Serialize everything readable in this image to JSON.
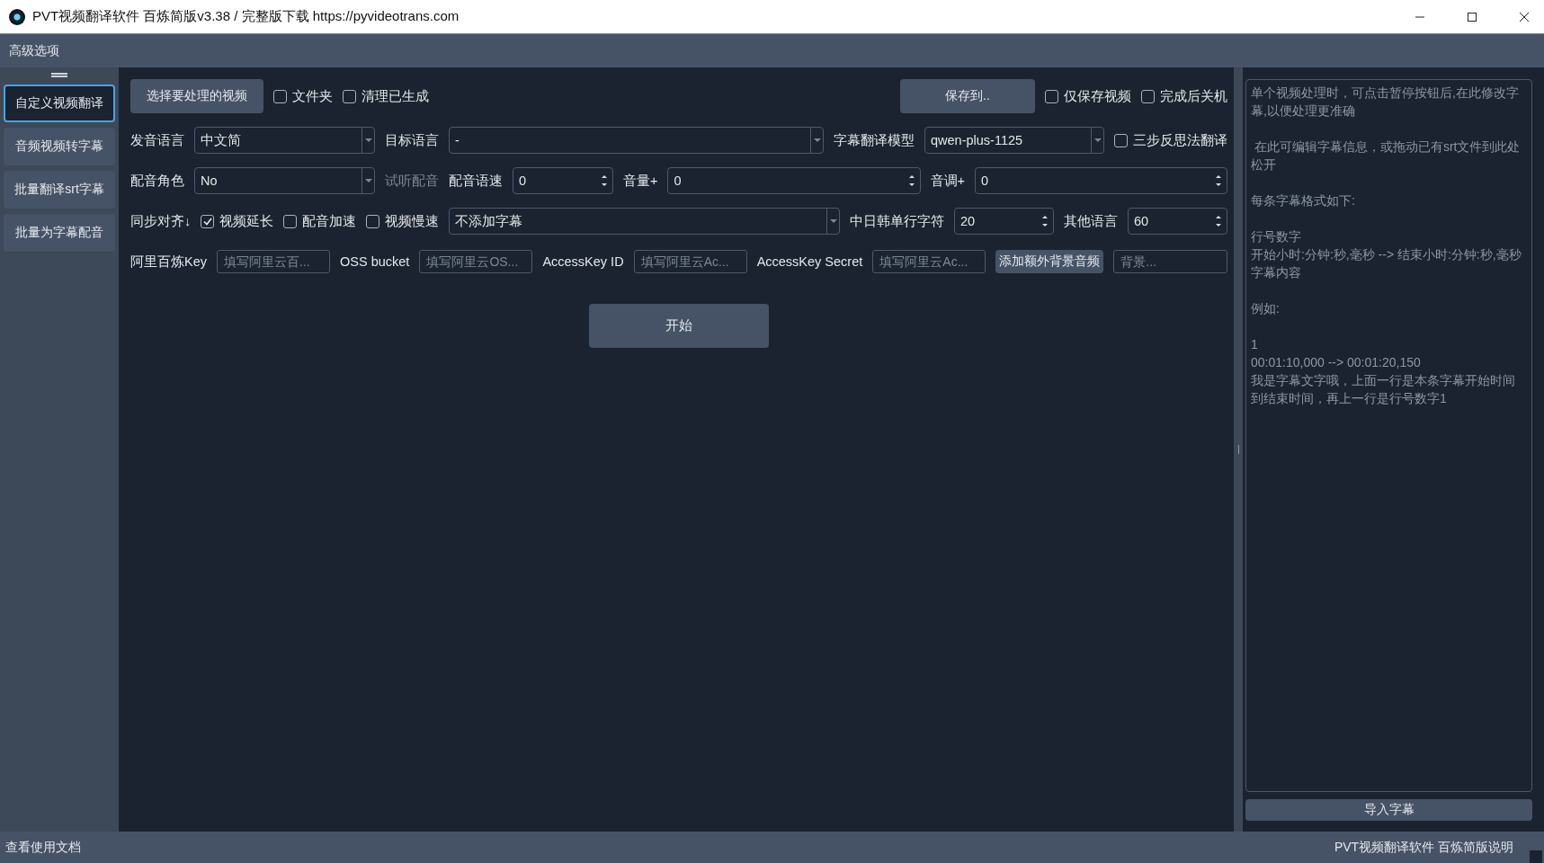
{
  "window": {
    "title": "PVT视频翻译软件 百炼简版v3.38 / 完整版下载 https://pyvideotrans.com"
  },
  "menu": [
    "高级选项"
  ],
  "sidebar": {
    "items": [
      {
        "label": "自定义视频翻译",
        "selected": true
      },
      {
        "label": "音频视频转字幕",
        "selected": false
      },
      {
        "label": "批量翻译srt字幕",
        "selected": false
      },
      {
        "label": "批量为字幕配音",
        "selected": false
      }
    ]
  },
  "form_rows": [
    [
      {
        "kind": "button",
        "label": "选择要处理的视频"
      },
      {
        "kind": "check",
        "label": "文件夹",
        "checked": false
      },
      {
        "kind": "check",
        "label": "清理已生成",
        "checked": false
      },
      {
        "kind": "button",
        "label": "保存到.."
      },
      {
        "kind": "check",
        "label": "仅保存视频",
        "checked": false
      },
      {
        "kind": "check",
        "label": "完成后关机",
        "checked": false
      }
    ],
    [
      {
        "kind": "label",
        "label": "发音语言"
      },
      {
        "kind": "combo",
        "value": "中文简"
      },
      {
        "kind": "label",
        "label": "目标语言"
      },
      {
        "kind": "combo",
        "value": "-"
      },
      {
        "kind": "label",
        "label": "字幕翻译模型"
      },
      {
        "kind": "combo",
        "value": "qwen-plus-1125"
      },
      {
        "kind": "check",
        "label": "三步反思法翻译",
        "checked": false
      }
    ],
    [
      {
        "kind": "label",
        "label": "配音角色"
      },
      {
        "kind": "combo",
        "value": "No"
      },
      {
        "kind": "label",
        "label": "试听配音",
        "disabled": true
      },
      {
        "kind": "label",
        "label": "配音语速"
      },
      {
        "kind": "spin",
        "value": "0"
      },
      {
        "kind": "label",
        "label": "音量+"
      },
      {
        "kind": "spin",
        "value": "0"
      },
      {
        "kind": "label",
        "label": "音调+"
      },
      {
        "kind": "spin",
        "value": "0"
      }
    ],
    [
      {
        "kind": "label",
        "label": "同步对齐↓"
      },
      {
        "kind": "check",
        "label": "视频延长",
        "checked": true
      },
      {
        "kind": "check",
        "label": "配音加速",
        "checked": false
      },
      {
        "kind": "check",
        "label": "视频慢速",
        "checked": false
      },
      {
        "kind": "combo",
        "value": "不添加字幕"
      },
      {
        "kind": "label",
        "label": "中日韩单行字符"
      },
      {
        "kind": "spin",
        "value": "20"
      },
      {
        "kind": "label",
        "label": "其他语言"
      },
      {
        "kind": "spin",
        "value": "60"
      }
    ],
    [
      {
        "kind": "label",
        "label": "阿里百炼Key"
      },
      {
        "kind": "input",
        "placeholder": "填写阿里云百..."
      },
      {
        "kind": "label",
        "label": "OSS bucket"
      },
      {
        "kind": "input",
        "placeholder": "填写阿里云OS..."
      },
      {
        "kind": "label",
        "label": "AccessKey ID"
      },
      {
        "kind": "input",
        "placeholder": "填写阿里云Ac..."
      },
      {
        "kind": "label",
        "label": "AccessKey Secret"
      },
      {
        "kind": "input",
        "placeholder": "填写阿里云Ac..."
      },
      {
        "kind": "button",
        "label": "添加额外背景音频"
      },
      {
        "kind": "input",
        "placeholder": "背景..."
      }
    ]
  ],
  "start_button": "开始",
  "subtitle_editor": {
    "paragraphs": [
      [
        "单个视频处理时，可点击暂停按钮后,在此修改字幕,以便处理更准确"
      ],
      [
        " 在此可编辑字幕信息，或拖动已有srt文件到此处松开"
      ],
      [
        "每条字幕格式如下:"
      ],
      [
        "行号数字",
        "开始小时:分钟:秒,毫秒 --> 结束小时:分钟:秒,毫秒",
        "字幕内容"
      ],
      [
        "例如:"
      ],
      [
        "1",
        "00:01:10,000 --> 00:01:20,150",
        "我是字幕文字哦，上面一行是本条字幕开始时间到结束时间，再上一行是行号数字1"
      ]
    ]
  },
  "import_button": "导入字幕",
  "status_bar": {
    "left": "查看使用文档",
    "right": "PVT视频翻译软件 百炼简版说明"
  }
}
